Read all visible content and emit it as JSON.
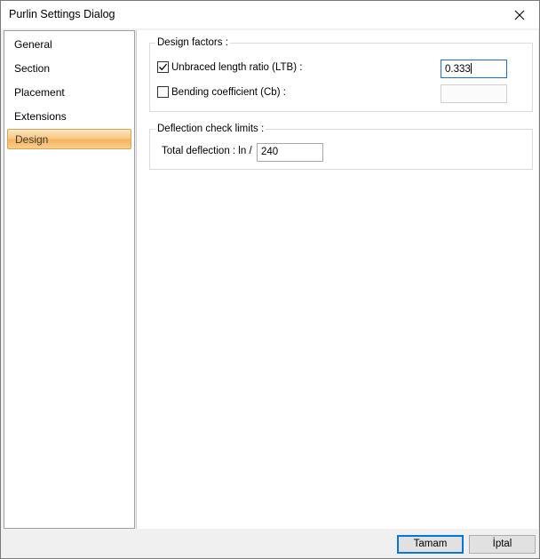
{
  "window": {
    "title": "Purlin Settings Dialog",
    "close_icon": "close-icon"
  },
  "sidebar": {
    "items": [
      {
        "label": "General",
        "active": false
      },
      {
        "label": "Section",
        "active": false
      },
      {
        "label": "Placement",
        "active": false
      },
      {
        "label": "Extensions",
        "active": false
      },
      {
        "label": "Design",
        "active": true
      }
    ],
    "active_color": "#f9c985"
  },
  "design_factors": {
    "group_label": "Design factors :",
    "unbraced": {
      "label": "Unbraced length ratio (LTB) :",
      "checked": true,
      "value": "0.333"
    },
    "bending": {
      "label": "Bending coefficient (Cb) :",
      "checked": false,
      "value": ""
    }
  },
  "deflection": {
    "group_label": "Deflection check limits :",
    "total_label": "Total deflection : ln /",
    "value": "240"
  },
  "buttons": {
    "ok_label": "Tamam",
    "cancel_label": "İptal"
  },
  "colors": {
    "focus_border": "#1e6fc4",
    "default_button_border": "#0078d7"
  }
}
